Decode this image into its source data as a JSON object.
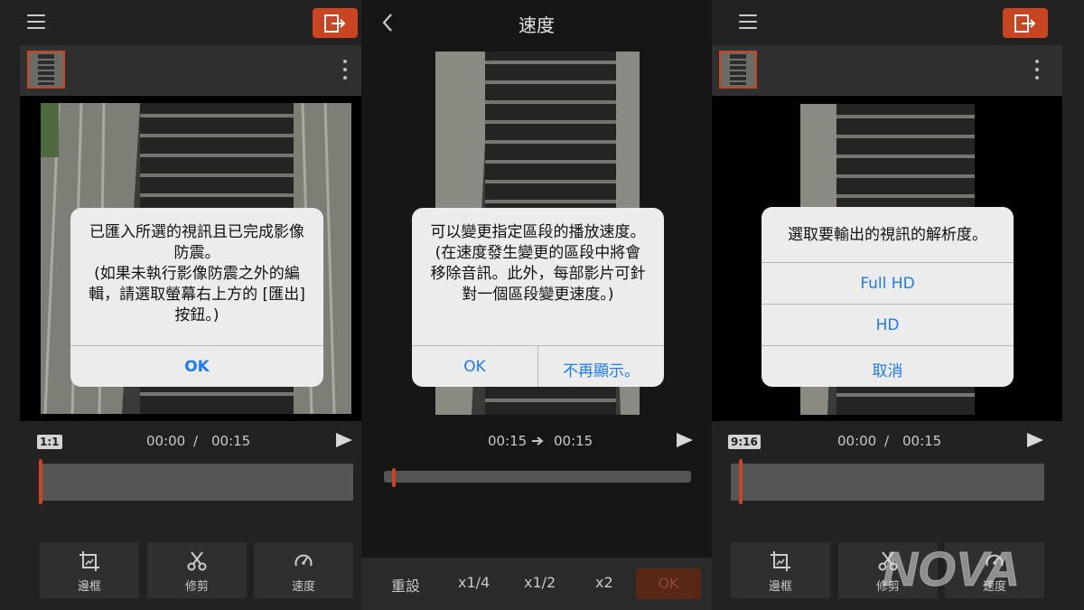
{
  "panel1": {
    "dialog": {
      "message": "已匯入所選的視訊且已完成影像防震。\n(如果未執行影像防震之外的編輯，請選取螢幕右上方的 [匯出] 按鈕。)",
      "ok": "OK"
    },
    "ratio": "1:1",
    "time_current": "00:00",
    "time_sep": "/",
    "time_total": "00:15",
    "tools": [
      {
        "label": "邊框",
        "icon": "frame-icon"
      },
      {
        "label": "修剪",
        "icon": "scissors-icon"
      },
      {
        "label": "速度",
        "icon": "speed-gauge-icon"
      }
    ]
  },
  "panel2": {
    "title": "速度",
    "dialog": {
      "message": "可以變更指定區段的播放速度。\n(在速度發生變更的區段中將會移除音訊。此外，每部影片可針對一個區段變更速度。)",
      "ok": "OK",
      "dont_show": "不再顯示。"
    },
    "time_start": "00:15",
    "time_end": "00:15",
    "speed_options": [
      "重設",
      "x1/4",
      "x1/2",
      "x2"
    ],
    "ok": "OK"
  },
  "panel3": {
    "dialog": {
      "message": "選取要輸出的視訊的解析度。",
      "options": [
        "Full HD",
        "HD",
        "取消"
      ]
    },
    "ratio": "9:16",
    "time_current": "00:00",
    "time_sep": "/",
    "time_total": "00:15",
    "tools": [
      {
        "label": "邊框",
        "icon": "frame-icon"
      },
      {
        "label": "修剪",
        "icon": "scissors-icon"
      },
      {
        "label": "速度",
        "icon": "speed-gauge-icon"
      }
    ]
  },
  "watermark": "NOVA",
  "colors": {
    "accent": "#c94420",
    "link": "#1d7cf2",
    "dialog_bg": "#ececec"
  }
}
